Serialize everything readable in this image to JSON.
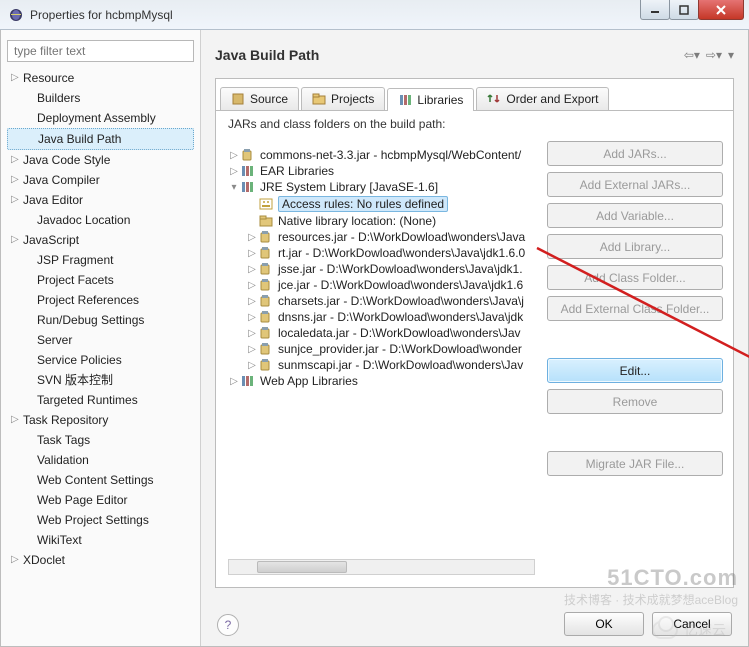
{
  "window": {
    "title": "Properties for hcbmpMysql"
  },
  "filter_placeholder": "type filter text",
  "nav": {
    "items": [
      {
        "label": "Resource",
        "expandable": true,
        "indent": 0
      },
      {
        "label": "Builders",
        "expandable": false,
        "indent": 1
      },
      {
        "label": "Deployment Assembly",
        "expandable": false,
        "indent": 1
      },
      {
        "label": "Java Build Path",
        "expandable": false,
        "indent": 1,
        "selected": true
      },
      {
        "label": "Java Code Style",
        "expandable": true,
        "indent": 0
      },
      {
        "label": "Java Compiler",
        "expandable": true,
        "indent": 0
      },
      {
        "label": "Java Editor",
        "expandable": true,
        "indent": 0
      },
      {
        "label": "Javadoc Location",
        "expandable": false,
        "indent": 1
      },
      {
        "label": "JavaScript",
        "expandable": true,
        "indent": 0
      },
      {
        "label": "JSP Fragment",
        "expandable": false,
        "indent": 1
      },
      {
        "label": "Project Facets",
        "expandable": false,
        "indent": 1
      },
      {
        "label": "Project References",
        "expandable": false,
        "indent": 1
      },
      {
        "label": "Run/Debug Settings",
        "expandable": false,
        "indent": 1
      },
      {
        "label": "Server",
        "expandable": false,
        "indent": 1
      },
      {
        "label": "Service Policies",
        "expandable": false,
        "indent": 1
      },
      {
        "label": "SVN 版本控制",
        "expandable": false,
        "indent": 1
      },
      {
        "label": "Targeted Runtimes",
        "expandable": false,
        "indent": 1
      },
      {
        "label": "Task Repository",
        "expandable": true,
        "indent": 0
      },
      {
        "label": "Task Tags",
        "expandable": false,
        "indent": 1
      },
      {
        "label": "Validation",
        "expandable": false,
        "indent": 1
      },
      {
        "label": "Web Content Settings",
        "expandable": false,
        "indent": 1
      },
      {
        "label": "Web Page Editor",
        "expandable": false,
        "indent": 1
      },
      {
        "label": "Web Project Settings",
        "expandable": false,
        "indent": 1
      },
      {
        "label": "WikiText",
        "expandable": false,
        "indent": 1
      },
      {
        "label": "XDoclet",
        "expandable": true,
        "indent": 0
      }
    ]
  },
  "page": {
    "title": "Java Build Path",
    "desc": "JARs and class folders on the build path:"
  },
  "tabs": [
    {
      "label": "Source",
      "icon": "source"
    },
    {
      "label": "Projects",
      "icon": "projects"
    },
    {
      "label": "Libraries",
      "icon": "libraries",
      "active": true
    },
    {
      "label": "Order and Export",
      "icon": "order"
    }
  ],
  "tree": [
    {
      "level": 1,
      "exp": "closed",
      "icon": "jar",
      "label": "commons-net-3.3.jar - hcbmpMysql/WebContent/"
    },
    {
      "level": 1,
      "exp": "closed",
      "icon": "lib",
      "label": "EAR Libraries"
    },
    {
      "level": 1,
      "exp": "open",
      "icon": "lib",
      "label": "JRE System Library [JavaSE-1.6]"
    },
    {
      "level": 2,
      "exp": "none",
      "icon": "access",
      "label": "Access rules: No rules defined",
      "selected": true
    },
    {
      "level": 2,
      "exp": "none",
      "icon": "native",
      "label": "Native library location: (None)"
    },
    {
      "level": 2,
      "exp": "closed",
      "icon": "jar",
      "label": "resources.jar - D:\\WorkDowload\\wonders\\Java"
    },
    {
      "level": 2,
      "exp": "closed",
      "icon": "jar",
      "label": "rt.jar - D:\\WorkDowload\\wonders\\Java\\jdk1.6.0"
    },
    {
      "level": 2,
      "exp": "closed",
      "icon": "jar",
      "label": "jsse.jar - D:\\WorkDowload\\wonders\\Java\\jdk1."
    },
    {
      "level": 2,
      "exp": "closed",
      "icon": "jar",
      "label": "jce.jar - D:\\WorkDowload\\wonders\\Java\\jdk1.6"
    },
    {
      "level": 2,
      "exp": "closed",
      "icon": "jar",
      "label": "charsets.jar - D:\\WorkDowload\\wonders\\Java\\j"
    },
    {
      "level": 2,
      "exp": "closed",
      "icon": "jar",
      "label": "dnsns.jar - D:\\WorkDowload\\wonders\\Java\\jdk"
    },
    {
      "level": 2,
      "exp": "closed",
      "icon": "jar",
      "label": "localedata.jar - D:\\WorkDowload\\wonders\\Jav"
    },
    {
      "level": 2,
      "exp": "closed",
      "icon": "jar",
      "label": "sunjce_provider.jar - D:\\WorkDowload\\wonder"
    },
    {
      "level": 2,
      "exp": "closed",
      "icon": "jar",
      "label": "sunmscapi.jar - D:\\WorkDowload\\wonders\\Jav"
    },
    {
      "level": 1,
      "exp": "closed",
      "icon": "lib",
      "label": "Web App Libraries"
    }
  ],
  "buttons": {
    "add_jars": "Add JARs...",
    "add_external_jars": "Add External JARs...",
    "add_variable": "Add Variable...",
    "add_library": "Add Library...",
    "add_class_folder": "Add Class Folder...",
    "add_external_class_folder": "Add External Class Folder...",
    "edit": "Edit...",
    "remove": "Remove",
    "migrate": "Migrate JAR File..."
  },
  "dialog": {
    "ok": "OK",
    "cancel": "Cancel"
  },
  "watermark": {
    "line1": "51CTO.com",
    "line2": "技术成就梦想aceBlog",
    "line3": "技术博客",
    "brand": "亿速云"
  }
}
